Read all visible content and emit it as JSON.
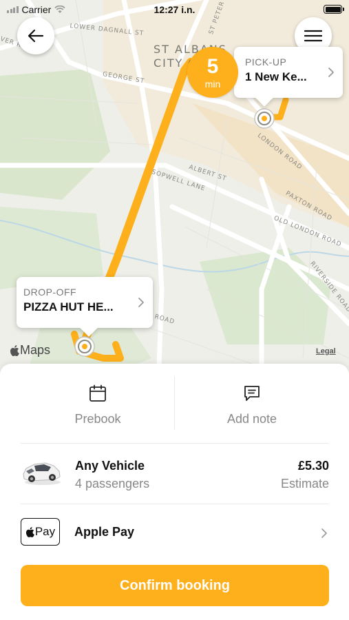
{
  "status_bar": {
    "carrier": "Carrier",
    "time": "12:27 i.n."
  },
  "map": {
    "streets": [
      "LOWER DAGNALL ST",
      "VER ROAD",
      "GEORGE ST",
      "ST PETER",
      "LONDON ROAD",
      "ALBERT ST",
      "SOPWELL LANE",
      "PAXTON ROAD",
      "OLD LONDON ROAD",
      "RIVERSIDE ROAD",
      "ROAD"
    ],
    "district": [
      "ST ALBANS",
      "CITY C"
    ],
    "maps_label": "Maps",
    "legal": "Legal"
  },
  "eta": {
    "value": "5",
    "unit": "min"
  },
  "pickup": {
    "caption": "PICK-UP",
    "value": "1 New Ke..."
  },
  "dropoff": {
    "caption": "DROP-OFF",
    "value": "PIZZA HUT HE..."
  },
  "actions": {
    "prebook": "Prebook",
    "add_note": "Add note"
  },
  "vehicle": {
    "name": "Any Vehicle",
    "passengers": "4 passengers",
    "price": "£5.30",
    "price_note": "Estimate"
  },
  "payment": {
    "badge": "Pay",
    "name": "Apple Pay"
  },
  "confirm_label": "Confirm booking",
  "colors": {
    "accent": "#fdb01b",
    "route": "#fdb01b",
    "map_bg": "#eeefe9"
  },
  "icons": [
    "back-arrow-icon",
    "hamburger-menu-icon",
    "calendar-icon",
    "note-icon",
    "car-icon",
    "apple-logo-icon",
    "chevron-right-icon",
    "wifi-icon",
    "signal-icon",
    "battery-icon"
  ]
}
